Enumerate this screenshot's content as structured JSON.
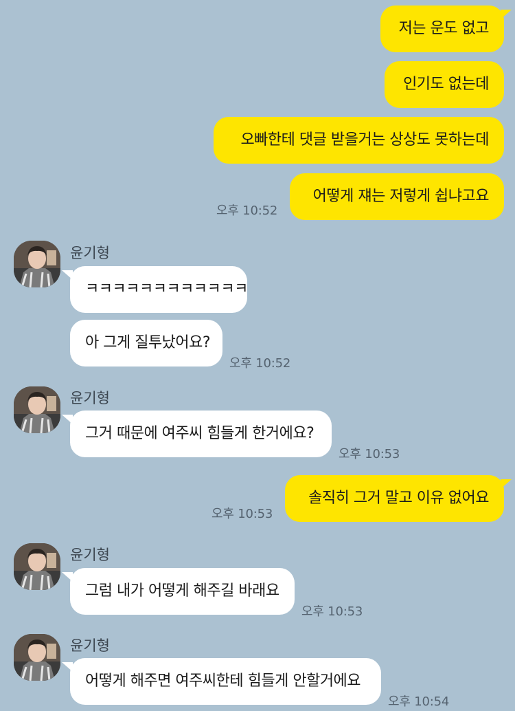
{
  "contact_name": "윤기형",
  "messages": [
    {
      "sender": "me",
      "text": "저는 운도 없고"
    },
    {
      "sender": "me",
      "text": "인기도 없는데"
    },
    {
      "sender": "me",
      "text": "오빠한테 댓글 받을거는 상상도 못하는데"
    },
    {
      "sender": "me",
      "text": "어떻게 쟤는 저렇게 쉽냐고요",
      "time": "오후 10:52"
    },
    {
      "sender": "them",
      "text": "ㅋㅋㅋㅋㅋㅋㅋㅋㅋㅋㅋㅋ"
    },
    {
      "sender": "them",
      "text": "아 그게 질투났어요?",
      "time": "오후 10:52"
    },
    {
      "sender": "them",
      "text": "그거 때문에 여주씨 힘들게 한거에요?",
      "time": "오후 10:53"
    },
    {
      "sender": "me",
      "text": "솔직히 그거 말고 이유 없어요",
      "time": "오후 10:53"
    },
    {
      "sender": "them",
      "text": "그럼 내가 어떻게 해주길 바래요",
      "time": "오후 10:53"
    },
    {
      "sender": "them",
      "text": "어떻게 해주면 여주씨한테 힘들게 안할거에요",
      "time": "오후 10:54"
    }
  ],
  "colors": {
    "background": "#abc1d1",
    "my_bubble": "#fee500",
    "their_bubble": "#ffffff"
  }
}
